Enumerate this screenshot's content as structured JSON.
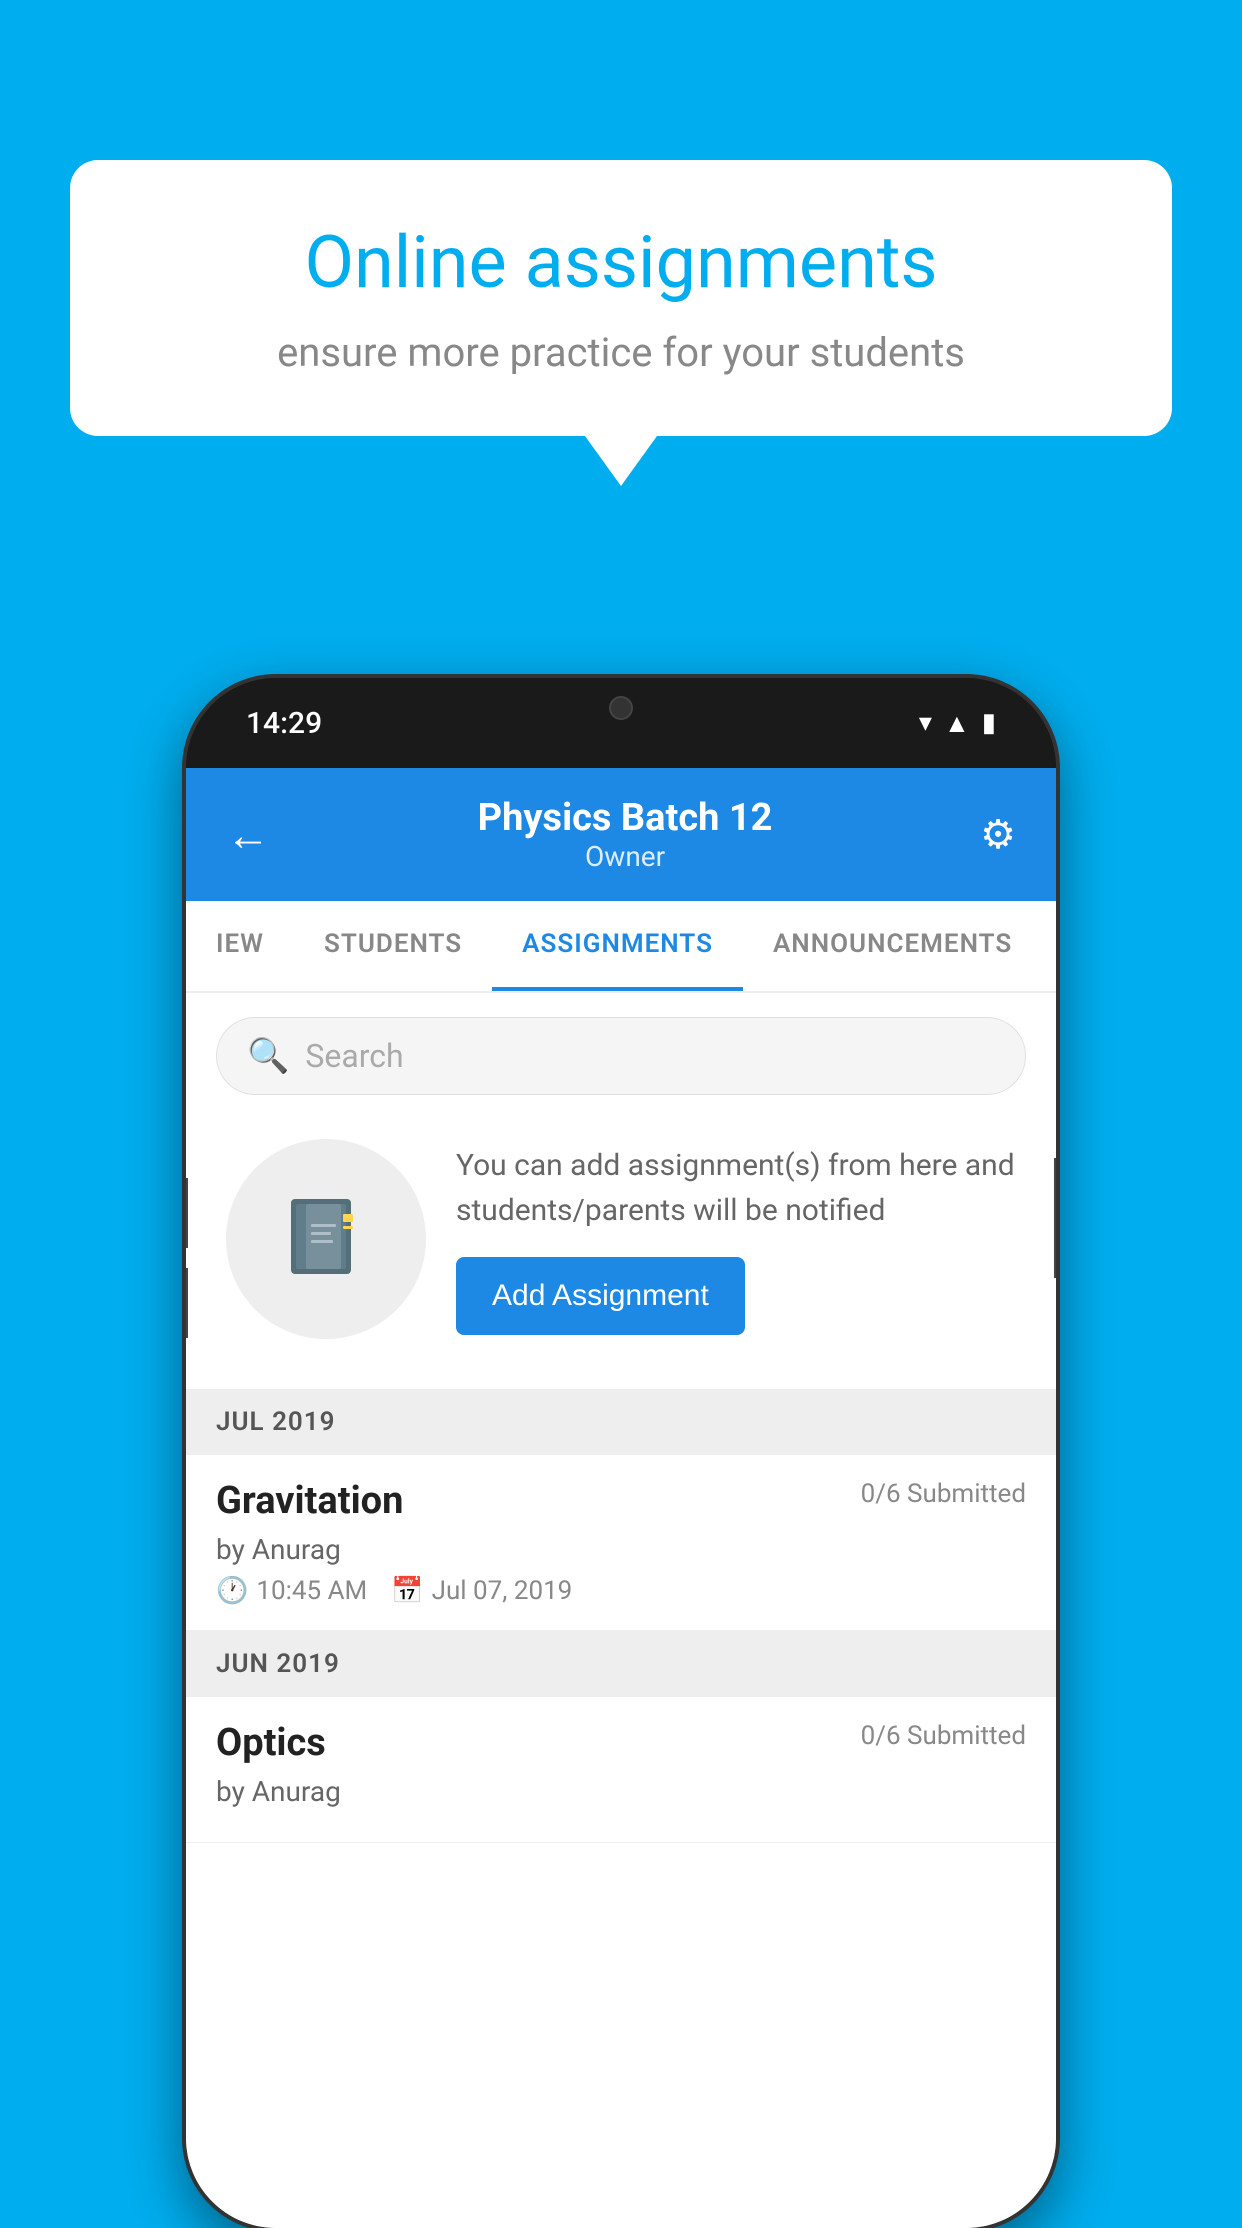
{
  "background_color": "#00AEEF",
  "speech_bubble": {
    "title": "Online assignments",
    "subtitle": "ensure more practice for your students"
  },
  "phone": {
    "status_bar": {
      "time": "14:29",
      "icons": [
        "wifi",
        "signal",
        "battery"
      ]
    },
    "app_bar": {
      "title": "Physics Batch 12",
      "subtitle": "Owner",
      "back_icon": "←",
      "settings_icon": "⚙"
    },
    "tabs": [
      {
        "label": "IEW",
        "active": false
      },
      {
        "label": "STUDENTS",
        "active": false
      },
      {
        "label": "ASSIGNMENTS",
        "active": true
      },
      {
        "label": "ANNOUNCEMENTS",
        "active": false
      }
    ],
    "search": {
      "placeholder": "Search"
    },
    "empty_state": {
      "description": "You can add assignment(s) from here and students/parents will be notified",
      "button_label": "Add Assignment"
    },
    "sections": [
      {
        "header": "JUL 2019",
        "assignments": [
          {
            "name": "Gravitation",
            "submitted": "0/6 Submitted",
            "author": "by Anurag",
            "time": "10:45 AM",
            "date": "Jul 07, 2019"
          }
        ]
      },
      {
        "header": "JUN 2019",
        "assignments": [
          {
            "name": "Optics",
            "submitted": "0/6 Submitted",
            "author": "by Anurag",
            "time": "",
            "date": ""
          }
        ]
      }
    ]
  }
}
